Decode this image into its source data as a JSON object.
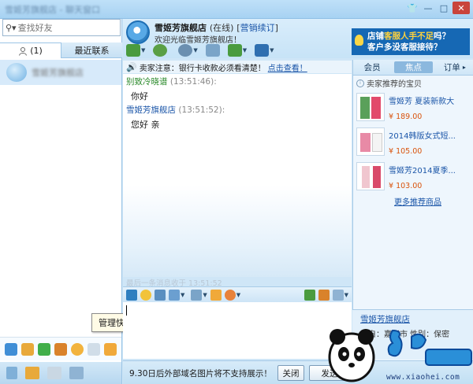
{
  "window": {
    "title": "雪姬芳旗舰店 - 聊天窗口"
  },
  "left": {
    "search_placeholder": "查找好友",
    "tab_contacts": "(1)",
    "tab_recent": "最近联系",
    "contact_name": "雪姬芳旗舰店",
    "tooltip": "管理快捷入口"
  },
  "header": {
    "shop_name": "雪姬芳旗舰店",
    "status": "(在线)",
    "link_open": "[",
    "link": "营销续订",
    "link_close": "]",
    "welcome": "欢迎光临雪姬芳旗舰店！"
  },
  "promo": {
    "line1_pre": "店铺",
    "line1_hl": "客服人手不足",
    "line1_post": "吗？",
    "line2": "客户多没客服接待？"
  },
  "notice": {
    "text": "卖家注意：银行卡收款必须看清楚！",
    "link": "点击查看！"
  },
  "messages": [
    {
      "sender": "别致冷晓谱",
      "time": "(13:51:46):",
      "body": "你好"
    },
    {
      "sender": "雪姬芳旗舰店",
      "time": "(13:51:52):",
      "body": "您好 亲"
    }
  ],
  "last_msg": "最后一条消息收于 13:51:52",
  "right": {
    "tabs": [
      "会员",
      "焦点",
      "订单"
    ],
    "tab_more": "▸",
    "rec_title": "卖家推荐的宝贝",
    "products": [
      {
        "name": "雪姬芳 夏装新款大",
        "price": "¥ 189.00"
      },
      {
        "name": "2014韩版女式短...",
        "price": "¥ 105.00"
      },
      {
        "name": "雪姬芳2014夏季...",
        "price": "¥ 103.00"
      }
    ],
    "more": "更多推荐商品"
  },
  "shopcard": {
    "name": "雪姬芳旗舰店",
    "location": "来自：嘉兴市  性别：保密"
  },
  "footer": {
    "tip": "9.30日后外部域名图片将不支持展示！",
    "close": "关闭",
    "send": "发送"
  },
  "watermark": {
    "site": "www.xiaohei.com"
  },
  "colors": {
    "accent": "#1668b4",
    "link": "#1a55a8",
    "price": "#d9530c"
  }
}
